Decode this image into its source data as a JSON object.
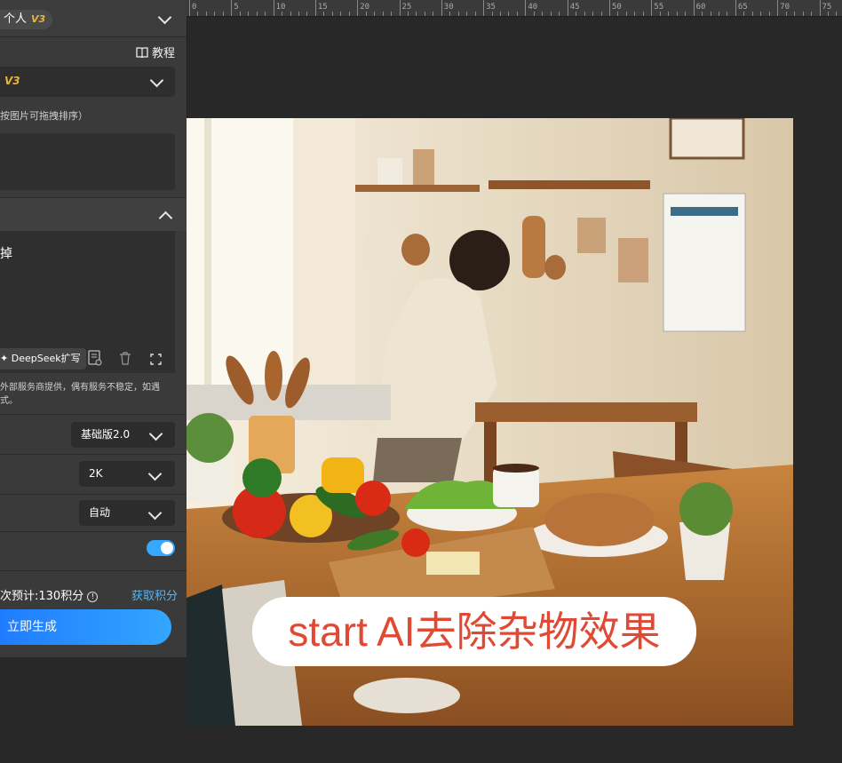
{
  "panel": {
    "account_label": "个人",
    "account_badge": "V3",
    "tutorial_label": "教程",
    "model_badge": "V3",
    "image_hint": "按图片可拖拽排序）",
    "prompt_text": "掉",
    "deepseek_label": "DeepSeek扩写",
    "service_note_line1": "外部服务商提供，偶有服务不稳定，如遇",
    "service_note_line2": "式。",
    "version_value": "基础版2.0",
    "resolution_value": "2K",
    "ratio_value": "自动",
    "toggle_on": true,
    "estimate_text": "次预计:130积分",
    "get_points_label": "获取积分",
    "generate_label": "立即生成"
  },
  "ruler": {
    "ticks": [
      "0",
      "5",
      "10",
      "15",
      "20",
      "25",
      "30",
      "35",
      "40",
      "45",
      "50",
      "55",
      "60",
      "65",
      "70",
      "75"
    ]
  },
  "canvas": {
    "caption": "start AI去除杂物效果"
  },
  "colors": {
    "accent_blue": "#33a6ff",
    "badge_gold": "#e8b43c",
    "caption_red": "#e04a35"
  }
}
